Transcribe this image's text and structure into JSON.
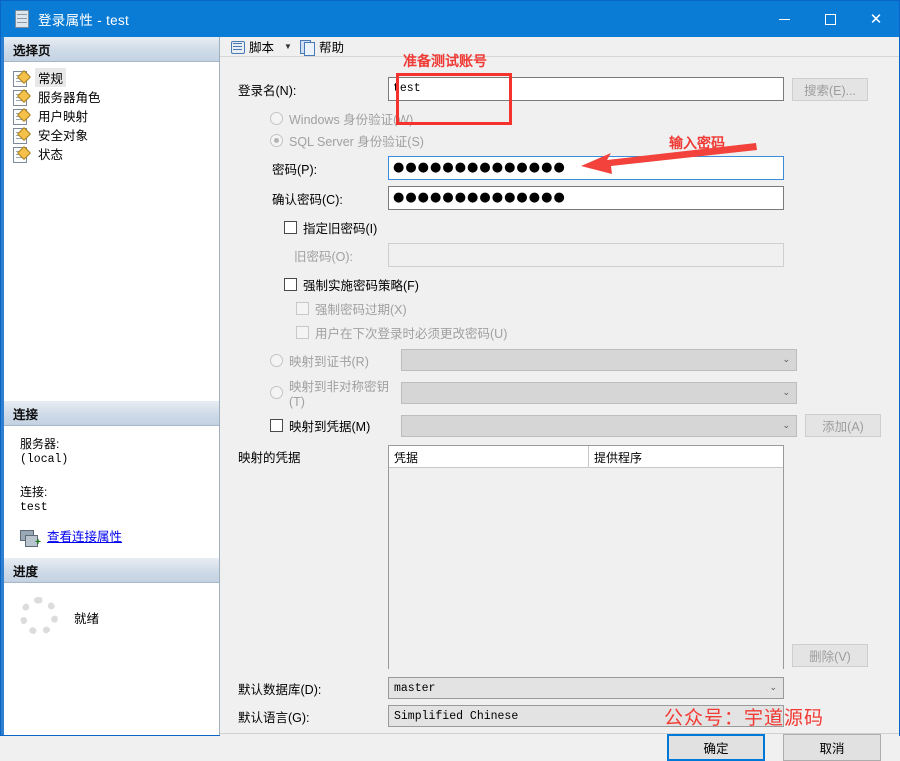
{
  "window": {
    "title": "登录属性 - test",
    "icon": "server-icon",
    "minimize": "–",
    "maximize": "□",
    "close": "✕"
  },
  "sidebar": {
    "select_page_header": "选择页",
    "items": [
      {
        "label": "常规",
        "selected": true
      },
      {
        "label": "服务器角色",
        "selected": false
      },
      {
        "label": "用户映射",
        "selected": false
      },
      {
        "label": "安全对象",
        "selected": false
      },
      {
        "label": "状态",
        "selected": false
      }
    ],
    "connection": {
      "header": "连接",
      "server_label": "服务器:",
      "server_value": "(local)",
      "connection_label": "连接:",
      "connection_value": "test",
      "view_properties_link": "查看连接属性"
    },
    "progress": {
      "header": "进度",
      "status": "就绪"
    }
  },
  "toolbar": {
    "script_label": "脚本",
    "script_dropdown": "▼",
    "help_label": "帮助"
  },
  "form": {
    "login_name_label": "登录名(N):",
    "login_name_value": "test",
    "search_button": "搜索(E)...",
    "windows_auth_label": "Windows 身份验证(W)",
    "sql_auth_label": "SQL Server 身份验证(S)",
    "password_label": "密码(P):",
    "password_value": "●●●●●●●●●●●●●●",
    "confirm_password_label": "确认密码(C):",
    "confirm_password_value": "●●●●●●●●●●●●●●",
    "specify_old_password_label": "指定旧密码(I)",
    "old_password_label": "旧密码(O):",
    "old_password_value": "",
    "enforce_policy_label": "强制实施密码策略(F)",
    "enforce_expiration_label": "强制密码过期(X)",
    "must_change_label": "用户在下次登录时必须更改密码(U)",
    "map_certificate_label": "映射到证书(R)",
    "map_certificate_value": "",
    "map_asymmetric_label": "映射到非对称密钥(T)",
    "map_asymmetric_value": "",
    "map_credential_label": "映射到凭据(M)",
    "map_credential_value": "",
    "add_button": "添加(A)",
    "mapped_credentials_label": "映射的凭据",
    "grid_col_credential": "凭据",
    "grid_col_provider": "提供程序",
    "grid_rows": [],
    "remove_button": "删除(V)",
    "default_database_label": "默认数据库(D):",
    "default_database_value": "master",
    "default_language_label": "默认语言(G):",
    "default_language_value": "Simplified Chinese",
    "chevron": "⌄"
  },
  "footer": {
    "ok_button": "确定",
    "cancel_button": "取消"
  },
  "annotations": {
    "prepare_account": "准备测试账号",
    "enter_password": "输入密码",
    "watermark": "公众号：宇道源码"
  },
  "colors": {
    "titlebar": "#0a7cd6",
    "annotation_red": "#f23a33",
    "link_blue": "#0000ee",
    "accent_blue": "#0078d7"
  }
}
